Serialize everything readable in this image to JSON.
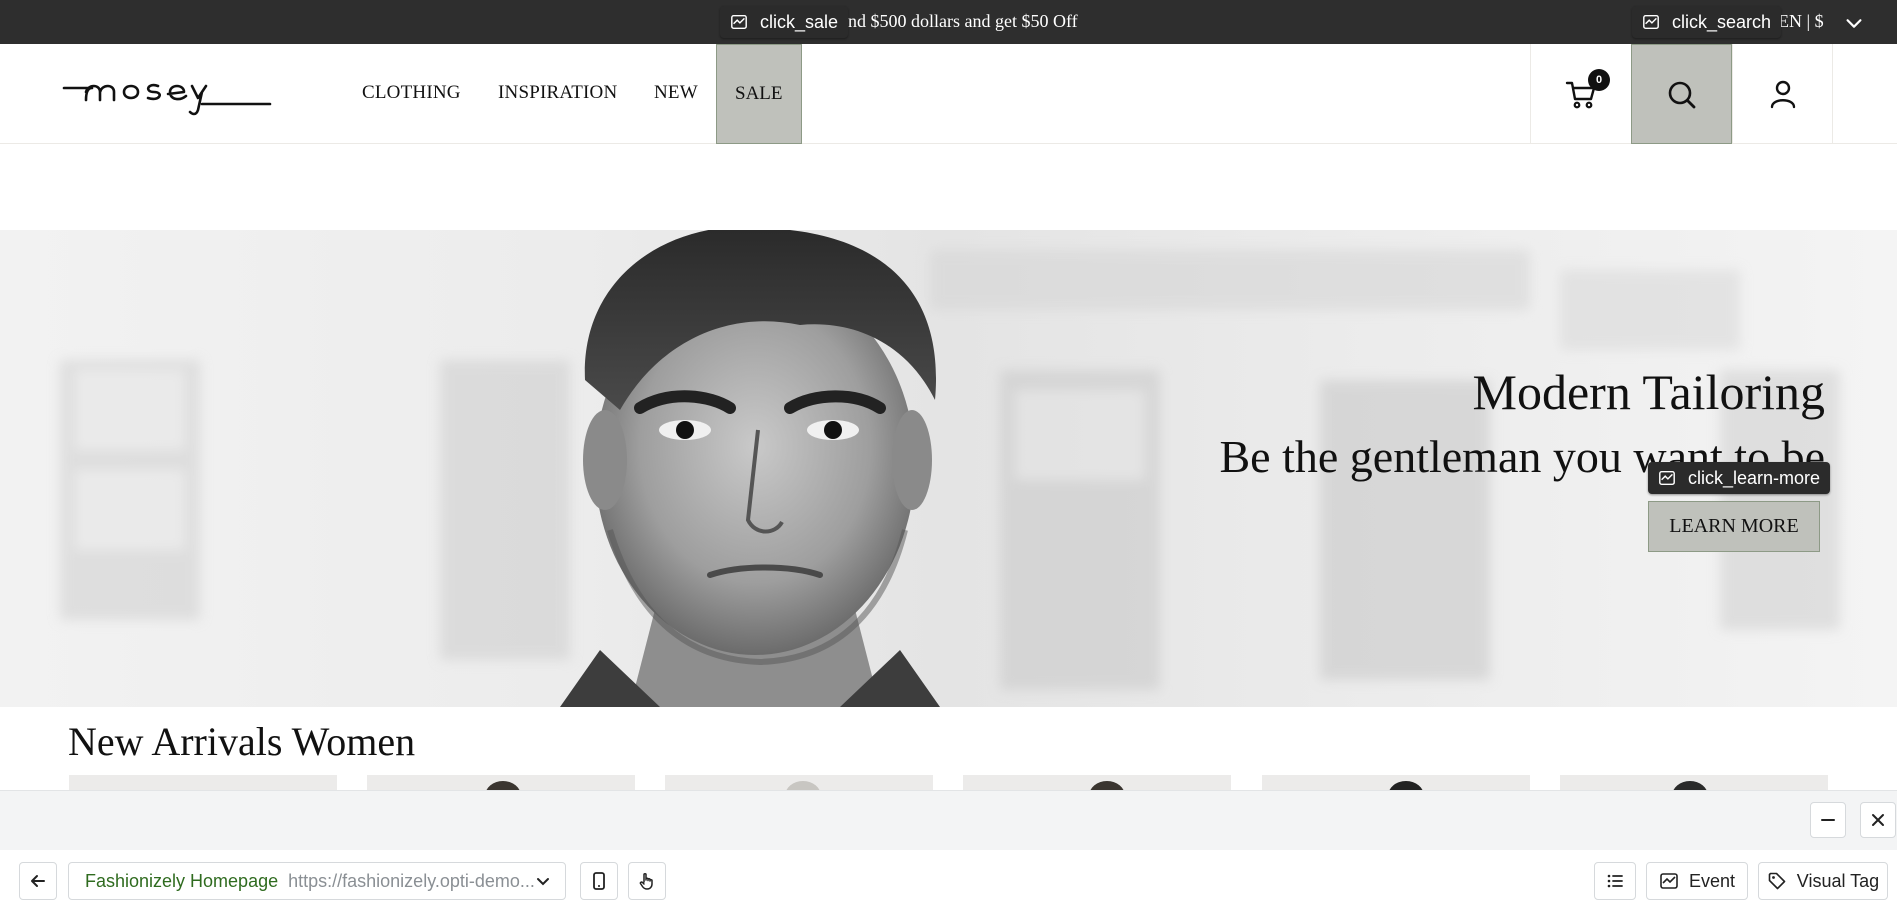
{
  "promo": {
    "text": "end $500 dollars and get $50 Off",
    "locale": "EN | $"
  },
  "tags": {
    "sale": "click_sale",
    "search": "click_search",
    "learn_more": "click_learn-more"
  },
  "header": {
    "logo_text": "mosey",
    "nav": [
      "CLOTHING",
      "INSPIRATION",
      "NEW",
      "SALE"
    ],
    "cart_count": "0"
  },
  "hero": {
    "title": "Modern Tailoring",
    "subtitle": "Be the gentleman you want to be",
    "cta": "LEARN MORE"
  },
  "arrivals": {
    "title": "New Arrivals Women"
  },
  "toolbar": {
    "page_name": "Fashionizely Homepage",
    "page_url": "https://fashionizely.opti-demo...",
    "event_label": "Event",
    "visual_tag_label": "Visual Tag"
  },
  "colors": {
    "promo_bg": "#2e2e2e",
    "highlight_bg": "#bfc1bb",
    "highlight_border": "#8d9a86",
    "tag_bg": "#2b2b2b",
    "page_name": "#2f6b1f"
  }
}
